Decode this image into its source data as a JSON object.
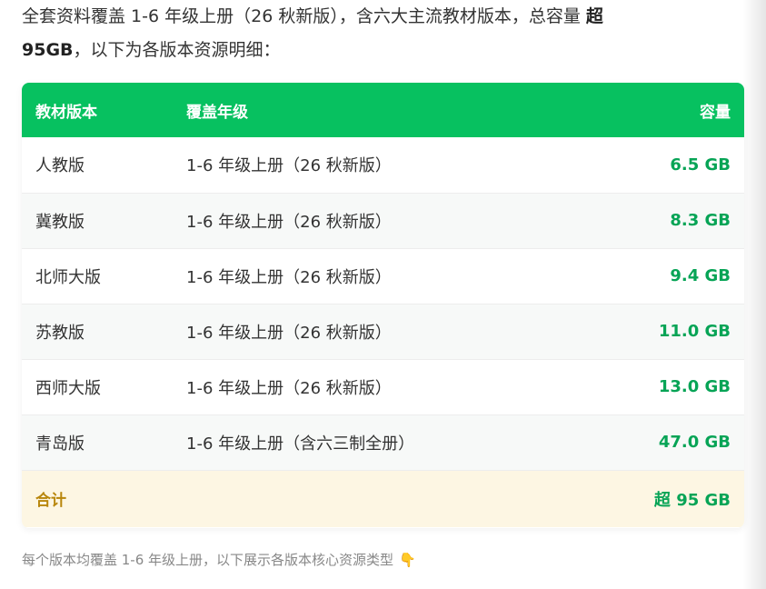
{
  "intro": {
    "part1": "全套资料覆盖 1-6 年级上册（26 秋新版），含六大主流教材版本，总容量 ",
    "bold1": "超",
    "bold2": "95GB",
    "part2": "，以下为各版本资源明细："
  },
  "table": {
    "headers": [
      "教材版本",
      "覆盖年级",
      "容量"
    ],
    "rows": [
      {
        "edition": "人教版",
        "grades": "1-6 年级上册（26 秋新版）",
        "capacity": "6.5 GB"
      },
      {
        "edition": "冀教版",
        "grades": "1-6 年级上册（26 秋新版）",
        "capacity": "8.3 GB"
      },
      {
        "edition": "北师大版",
        "grades": "1-6 年级上册（26 秋新版）",
        "capacity": "9.4 GB"
      },
      {
        "edition": "苏教版",
        "grades": "1-6 年级上册（26 秋新版）",
        "capacity": "11.0 GB"
      },
      {
        "edition": "西师大版",
        "grades": "1-6 年级上册（26 秋新版）",
        "capacity": "13.0 GB"
      },
      {
        "edition": "青岛版",
        "grades": "1-6 年级上册（含六三制全册）",
        "capacity": "47.0 GB"
      }
    ],
    "total": {
      "label": "合计",
      "capacity": "超 95 GB"
    }
  },
  "note": {
    "text": "每个版本均覆盖 1-6 年级上册，以下展示各版本核心资源类型",
    "emoji": "👇"
  },
  "colors": {
    "header_bg": "#07c160",
    "capacity_text": "#07a456",
    "total_bg": "#fdf6e3",
    "total_label": "#b8860b"
  }
}
